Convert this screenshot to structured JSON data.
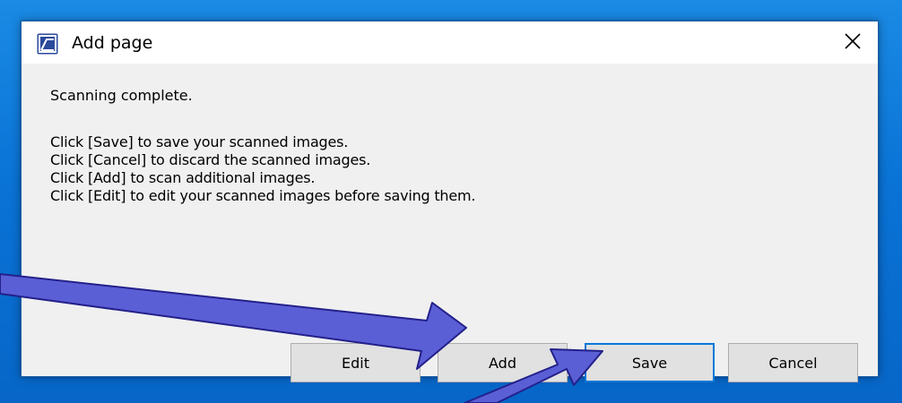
{
  "dialog": {
    "title": "Add page",
    "title_icon": "scanner-app-icon",
    "close_icon": "close-icon"
  },
  "message": {
    "headline": "Scanning complete.",
    "lines": [
      "Click [Save] to save your scanned images.",
      "Click [Cancel] to discard the scanned images.",
      "Click [Add] to scan additional images.",
      "Click [Edit] to edit your scanned images before saving them."
    ]
  },
  "buttons": {
    "edit": "Edit",
    "add": "Add",
    "save": "Save",
    "cancel": "Cancel",
    "default": "save"
  },
  "colors": {
    "desktop_background": "#0a73d6",
    "dialog_background": "#f0f0f0",
    "accent": "#0078d7",
    "annotation_arrow": "#5b5fd6"
  }
}
